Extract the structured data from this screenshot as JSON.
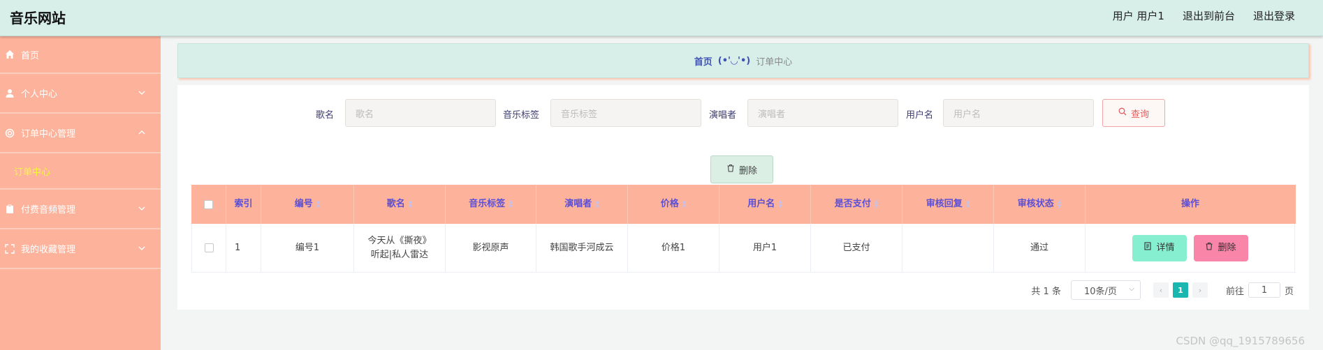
{
  "header": {
    "brand": "音乐网站",
    "user_label": "用户 用户1",
    "back_front_label": "退出到前台",
    "logout_label": "退出登录"
  },
  "sidebar": {
    "items": [
      {
        "label": "首页",
        "icon": "home-icon"
      },
      {
        "label": "个人中心",
        "icon": "user-icon"
      },
      {
        "label": "订单中心管理",
        "icon": "lifebuoy-icon"
      },
      {
        "label": "付费音频管理",
        "icon": "clipboard-icon"
      },
      {
        "label": "我的收藏管理",
        "icon": "fullscreen-icon"
      }
    ],
    "active_sub": "订单中心"
  },
  "breadcrumb": {
    "home": "首页",
    "separator": "(•'◡'•)",
    "current": "订单中心"
  },
  "search": {
    "song_label": "歌名",
    "song_placeholder": "歌名",
    "tag_label": "音乐标签",
    "tag_placeholder": "音乐标签",
    "singer_label": "演唱者",
    "singer_placeholder": "演唱者",
    "user_label": "用户名",
    "user_placeholder": "用户名",
    "query_label": "查询",
    "batch_delete_label": "删除"
  },
  "table": {
    "columns": [
      "索引",
      "编号",
      "歌名",
      "音乐标签",
      "演唱者",
      "价格",
      "用户名",
      "是否支付",
      "审核回复",
      "审核状态",
      "操作"
    ],
    "rows": [
      {
        "index": "1",
        "code": "编号1",
        "song_line1": "今天从《撕夜》",
        "song_line2": "听起|私人雷达",
        "tag": "影视原声",
        "singer": "韩国歌手河成云",
        "price": "价格1",
        "user": "用户1",
        "paid": "已支付",
        "reply": "",
        "status": "通过",
        "detail_label": "详情",
        "delete_label": "删除"
      }
    ]
  },
  "pagination": {
    "total_text": "共 1 条",
    "page_size": "10条/页",
    "current_page": "1",
    "goto_label": "前往",
    "goto_value": "1",
    "page_unit": "页"
  },
  "watermark": "CSDN @qq_1915789656",
  "colors": {
    "header_bg": "#d8efe9",
    "sidebar_bg": "#fdb39b",
    "table_header_bg": "#fdb39b",
    "accent_teal": "#19b7b0",
    "detail_button": "#86efcf",
    "delete_button": "#f985a8"
  }
}
